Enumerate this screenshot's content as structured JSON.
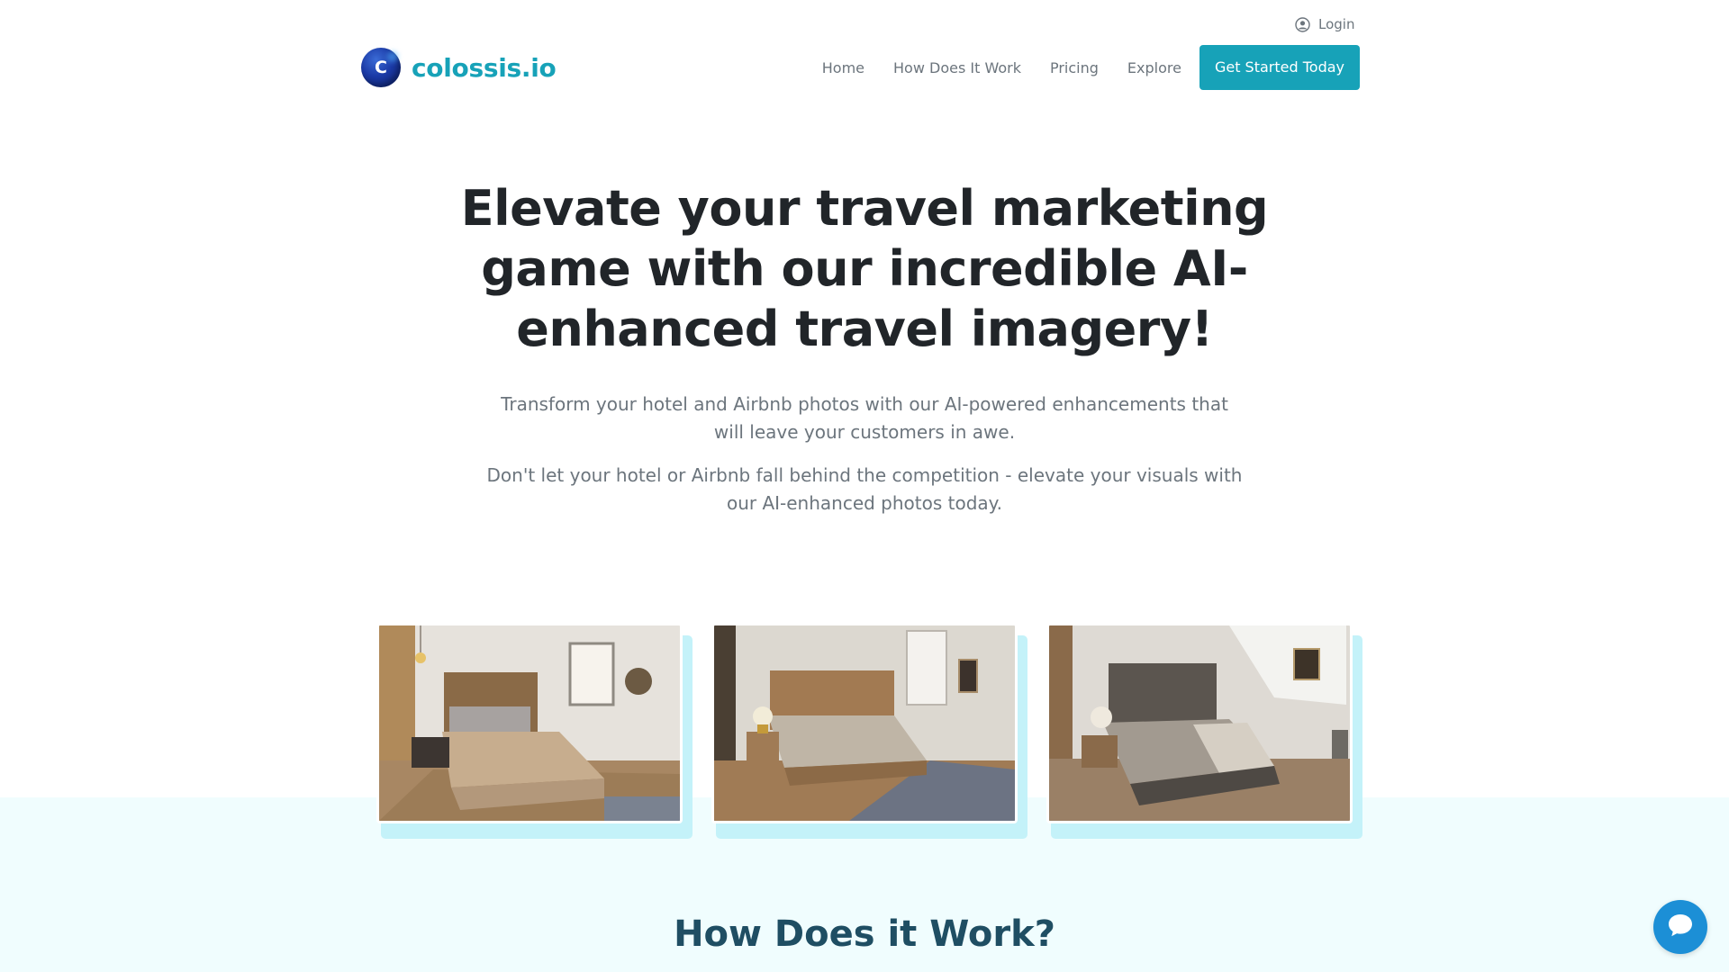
{
  "topbar": {
    "login_label": "Login",
    "login_icon": "user-circle-icon"
  },
  "brand": {
    "logo_letter": "C",
    "name": "colossis.io"
  },
  "nav": {
    "items": [
      {
        "label": "Home"
      },
      {
        "label": "How Does It Work"
      },
      {
        "label": "Pricing"
      },
      {
        "label": "Explore"
      }
    ],
    "cta_label": "Get Started Today"
  },
  "hero": {
    "title": "Elevate your travel marketing game with our incredible AI-enhanced travel imagery!",
    "subtitle_1": "Transform your hotel and Airbnb photos with our AI-powered enhancements that will leave your customers in awe.",
    "subtitle_2": "Don't let your hotel or Airbnb fall behind the competition - elevate your visuals with our AI-enhanced photos today."
  },
  "gallery": {
    "images": [
      {
        "subject": "bedroom-photo"
      },
      {
        "subject": "bedroom-photo"
      },
      {
        "subject": "bedroom-photo"
      }
    ]
  },
  "section": {
    "title": "How Does it Work?"
  },
  "chat": {
    "icon": "chat-bubble-icon"
  },
  "colors": {
    "accent": "#17a2b8",
    "band_bg": "#f0fdfe",
    "card_shadow": "#c4f2f9",
    "heading_dark": "#1f4e63",
    "chat_blue": "#1c8fd6"
  }
}
